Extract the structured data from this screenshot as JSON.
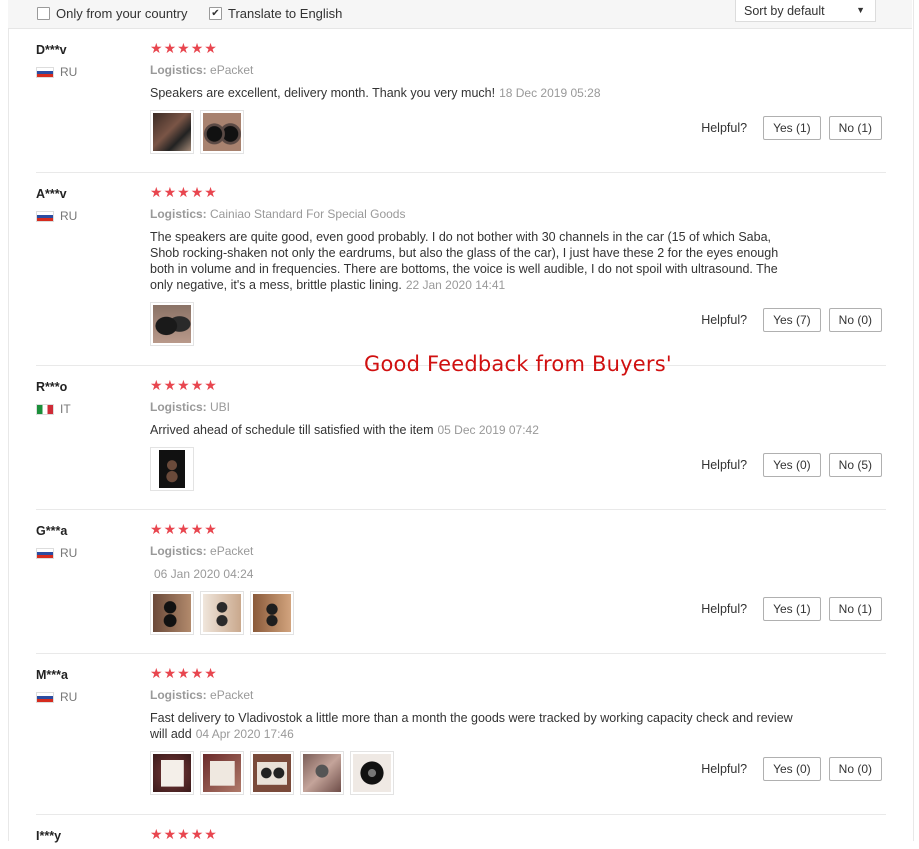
{
  "filters": {
    "only_country": "Only from your country",
    "only_country_checked": false,
    "translate": "Translate to English",
    "translate_checked": true,
    "sort_value": "Sort by default"
  },
  "overlay_caption": "Good Feedback from Buyers'",
  "helpful_label": "Helpful?",
  "logistics_label": "Logistics:",
  "reviews": [
    {
      "user": "D***v",
      "country": "RU",
      "rating": 5,
      "logistics": "ePacket",
      "text": "Speakers are excellent, delivery month. Thank you very much!",
      "date": "18 Dec 2019 05:28",
      "images": [
        "speaker-photo",
        "speaker-photo"
      ],
      "yes": "Yes (1)",
      "no": "No (1)"
    },
    {
      "user": "A***v",
      "country": "RU",
      "rating": 5,
      "logistics": "Cainiao Standard For Special Goods",
      "text": "The speakers are quite good, even good probably. I do not bother with 30 channels in the car (15 of which Saba, Shob rocking-shaken not only the eardrums, but also the glass of the car), I just have these 2 for the eyes enough both in volume and in frequencies. There are bottoms, the voice is well audible, I do not spoil with ultrasound. The only negative, it's a mess, brittle plastic lining.",
      "date": "22 Jan 2020 14:41",
      "images": [
        "speaker-photo"
      ],
      "yes": "Yes (7)",
      "no": "No (0)"
    },
    {
      "user": "R***o",
      "country": "IT",
      "rating": 5,
      "logistics": "UBI",
      "text": "Arrived ahead of schedule till satisfied with the item",
      "date": "05 Dec 2019 07:42",
      "images": [
        "speaker-photo"
      ],
      "yes": "Yes (0)",
      "no": "No (5)"
    },
    {
      "user": "G***a",
      "country": "RU",
      "rating": 5,
      "logistics": "ePacket",
      "text": "",
      "date": "06 Jan 2020 04:24",
      "images": [
        "speaker-photo",
        "speaker-photo",
        "speaker-photo"
      ],
      "yes": "Yes (1)",
      "no": "No (1)"
    },
    {
      "user": "M***a",
      "country": "RU",
      "rating": 5,
      "logistics": "ePacket",
      "text": "Fast delivery to Vladivostok a little more than a month the goods were tracked by working capacity check and review will add",
      "date": "04 Apr 2020 17:46",
      "images": [
        "speaker-photo",
        "speaker-photo",
        "speaker-photo",
        "speaker-photo",
        "speaker-photo"
      ],
      "yes": "Yes (0)",
      "no": "No (0)"
    },
    {
      "user": "I***y",
      "country": "",
      "rating": 5,
      "logistics": "",
      "text": "",
      "date": "",
      "images": [],
      "yes": "",
      "no": ""
    }
  ],
  "colors": {
    "star": "#e8464f",
    "overlay": "#d01010"
  }
}
